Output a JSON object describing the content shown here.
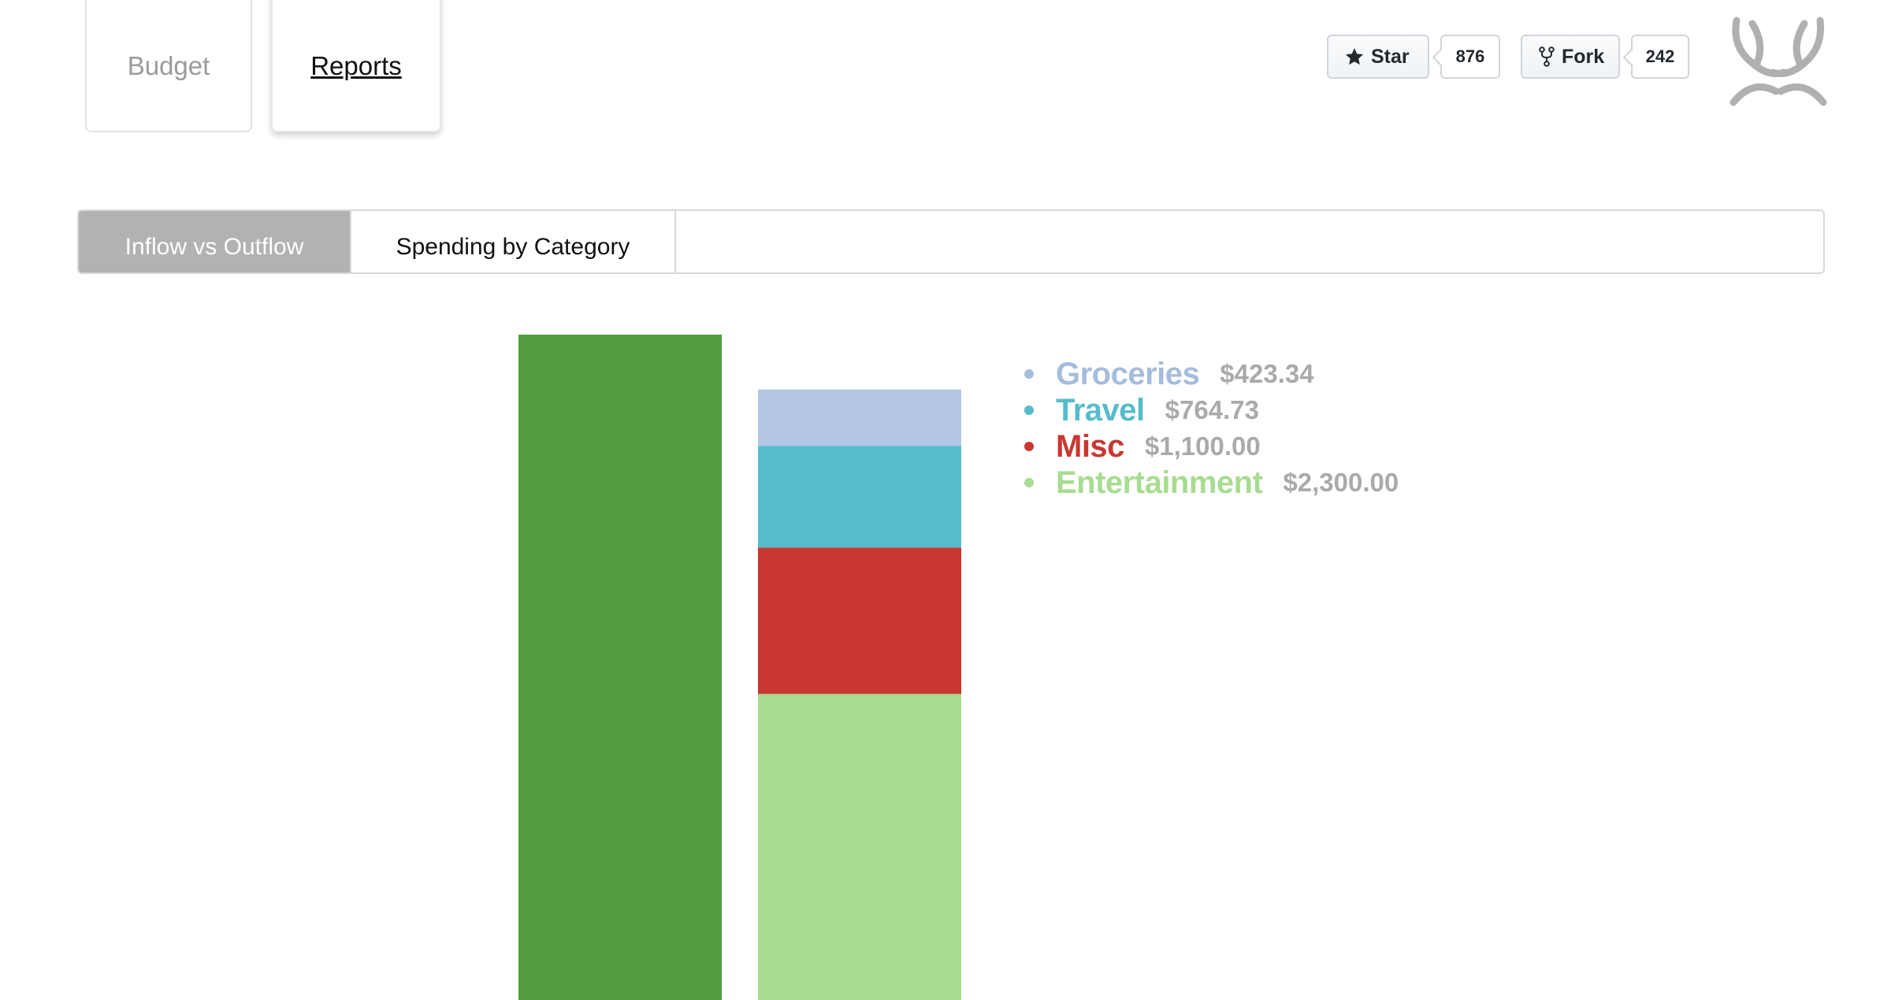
{
  "nav": {
    "tabs": [
      {
        "label": "Budget",
        "active": false
      },
      {
        "label": "Reports",
        "active": true
      }
    ]
  },
  "github": {
    "star_label": "Star",
    "star_count": "876",
    "fork_label": "Fork",
    "fork_count": "242"
  },
  "report_tabs": [
    {
      "label": "Inflow vs Outflow",
      "active": true
    },
    {
      "label": "Spending by Category",
      "active": false
    }
  ],
  "chart_data": {
    "type": "bar",
    "title": "",
    "xlabel": "",
    "ylabel": "",
    "series": [
      {
        "name": "Inflow",
        "color": "#519c3f",
        "values": [
          5000.0
        ]
      },
      {
        "name": "Outflow",
        "stacked": true,
        "segments": [
          {
            "name": "Groceries",
            "value": 423.34,
            "color": "#b3c6e6"
          },
          {
            "name": "Travel",
            "value": 764.73,
            "color": "#56bccc"
          },
          {
            "name": "Misc",
            "value": 1100.0,
            "color": "#c83831"
          },
          {
            "name": "Entertainment",
            "value": 2300.0,
            "color": "#a8dc91"
          }
        ]
      }
    ],
    "legend": [
      {
        "name": "Groceries",
        "amount": "$423.34",
        "color": "#a5bcdd"
      },
      {
        "name": "Travel",
        "amount": "$764.73",
        "color": "#56bccc"
      },
      {
        "name": "Misc",
        "amount": "$1,100.00",
        "color": "#c83831"
      },
      {
        "name": "Entertainment",
        "amount": "$2,300.00",
        "color": "#a8dc91"
      }
    ],
    "legend_placement": "top-right",
    "grid": false
  },
  "colors": {
    "inflow": "#519c3f",
    "active_tab": "#b2b2b2",
    "amount_text": "#aaaaaa"
  }
}
